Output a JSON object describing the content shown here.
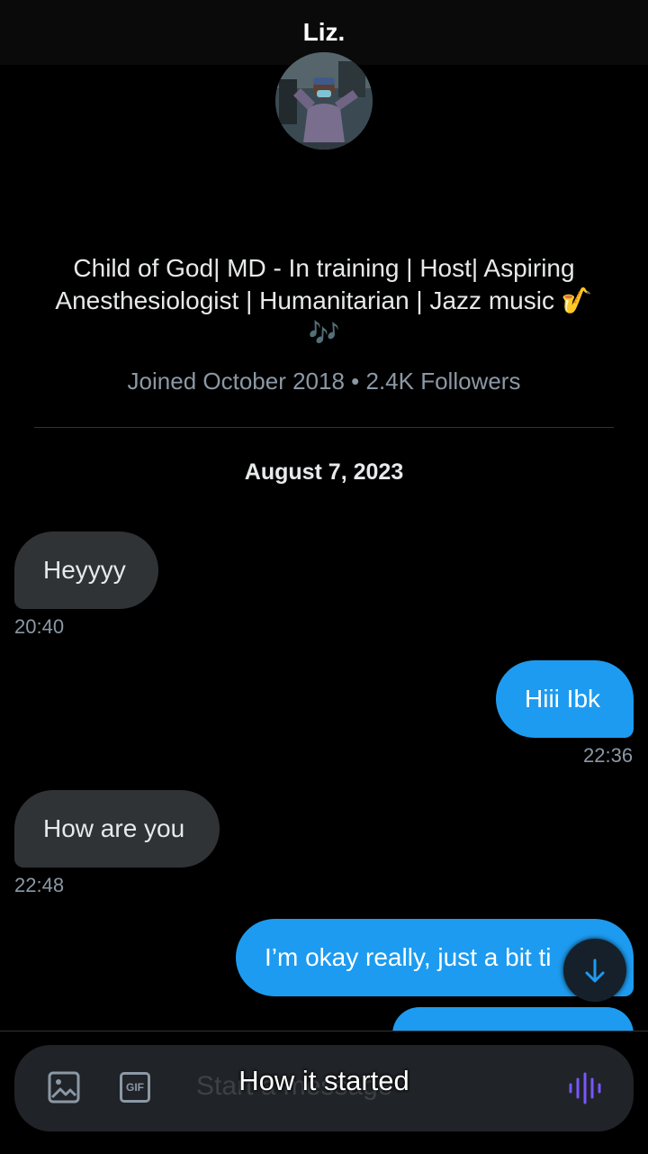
{
  "header": {
    "title": "Liz."
  },
  "profile": {
    "bio_line1": "Child of God| MD - In training | Host| Aspiring",
    "bio_line2": "Anesthesiologist | Humanitarian | Jazz music",
    "bio_emoji1": "🎷",
    "bio_emoji2": "🎶",
    "meta": "Joined October 2018 • 2.4K Followers"
  },
  "conversation": {
    "date": "August 7, 2023",
    "messages": [
      {
        "direction": "in",
        "text": "Heyyyy",
        "time": "20:40"
      },
      {
        "direction": "out",
        "text": "Hiii Ibk",
        "time": "22:36"
      },
      {
        "direction": "in",
        "text": "How are you",
        "time": "22:48"
      },
      {
        "direction": "out",
        "text": "I’m okay really, just a bit ti"
      }
    ]
  },
  "composer": {
    "gif_label": "GIF",
    "placeholder": "Start a message",
    "icons": [
      "image-icon",
      "gif-icon",
      "voice-icon"
    ]
  },
  "overlay": {
    "caption": "How it started"
  },
  "colors": {
    "accent": "#1d9bf0",
    "incoming_bubble": "#2f3336",
    "voice_icon": "#7856ff"
  }
}
